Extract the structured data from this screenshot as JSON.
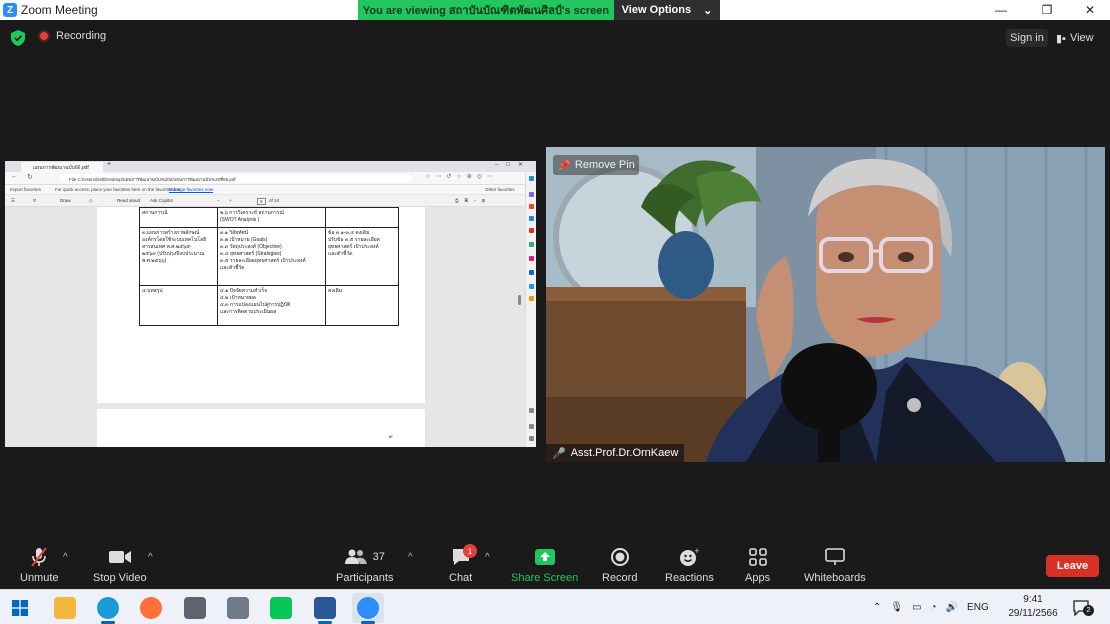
{
  "window": {
    "title": "Zoom Meeting",
    "share_banner": "You are viewing สถาบันบัณฑิตพัฒนศิลป์'s screen",
    "view_options": "View Options"
  },
  "topbar": {
    "recording": "Recording",
    "signin": "Sign in",
    "view": "View"
  },
  "shared_screen": {
    "tab_title": "แผนการพัฒนาฉบับ66.pdf",
    "url": "File   C:/Users/Dell/Desktop/แผนการพัฒนาฉบับ%202/แผนการพัฒนาฉบับ%20ที่66.pdf",
    "fav_import": "Import favorites",
    "fav_hint": "For quick access, place your favorites here on the favorites bar.",
    "fav_manage": "Manage favorites now",
    "fav_other": "Other favorites",
    "pdf_draw": "Draw",
    "pdf_read": "Read aloud",
    "pdf_copilot": "Ask Copilot",
    "pdf_page": "9",
    "pdf_of": "of 14",
    "page_number": "๙",
    "table": [
      {
        "c1": "สถานการณ์",
        "c2": "๒.๖ การวิเคราะห์ สถานการณ์\n(SWOT Analysis )",
        "c3": ""
      },
      {
        "c1": "๓.แผนการสร้างภาพลักษณ์\nองค์กรโดยใช้ระบบเทคโนโลยี\nสารสนเทศ พ.ศ.๒๕๖๕-\n๒๕๖๙ (ปรับปรุงปีงบประมาณ\nพ.ศ.๒๕๖๖)",
        "c2": "๓.๑ วิสัยทัศน์\n๓.๒ เป้าหมาย (Goals)\n๓.๓ วัตถุประสงค์ (Objective)\n๓.๔ ยุทธศาสตร์ (Strategies)\n๓.๕ รายละเอียดยุทธศาสตร์ เป้าประสงค์\nและตัวชี้วัด",
        "c3": "ข้อ ๓.๑-๓.๔ คงเดิม\nปรับข้อ ๓.๕ รายละเอียด\nยุทธศาสตร์ เป้าประสงค์\nและตัวชี้วัด"
      },
      {
        "c1": "๔.บทสรุป",
        "c2": "๔.๑ ปัจจัยความสำเร็จ\n๔.๒ เป้าหมายผล\n๔.๓ การแปลงแผนไปสู่การปฏิบัติ\nและการติดตามประเมินผล",
        "c3": "คงเดิม"
      }
    ]
  },
  "video": {
    "remove_pin": "Remove Pin",
    "participant_name": "Asst.Prof.Dr.OrnKaew"
  },
  "toolbar": {
    "unmute": "Unmute",
    "stop_video": "Stop Video",
    "participants": "Participants",
    "participants_count": "37",
    "chat": "Chat",
    "chat_badge": "1",
    "share_screen": "Share Screen",
    "record": "Record",
    "reactions": "Reactions",
    "apps": "Apps",
    "whiteboards": "Whiteboards",
    "leave": "Leave"
  },
  "taskbar": {
    "lang": "ENG",
    "time": "9:41",
    "date": "29/11/2566",
    "notif_count": "2"
  },
  "colors": {
    "share_green": "#22c55e",
    "leave_red": "#d93025",
    "zoom_blue": "#2d8cff"
  }
}
